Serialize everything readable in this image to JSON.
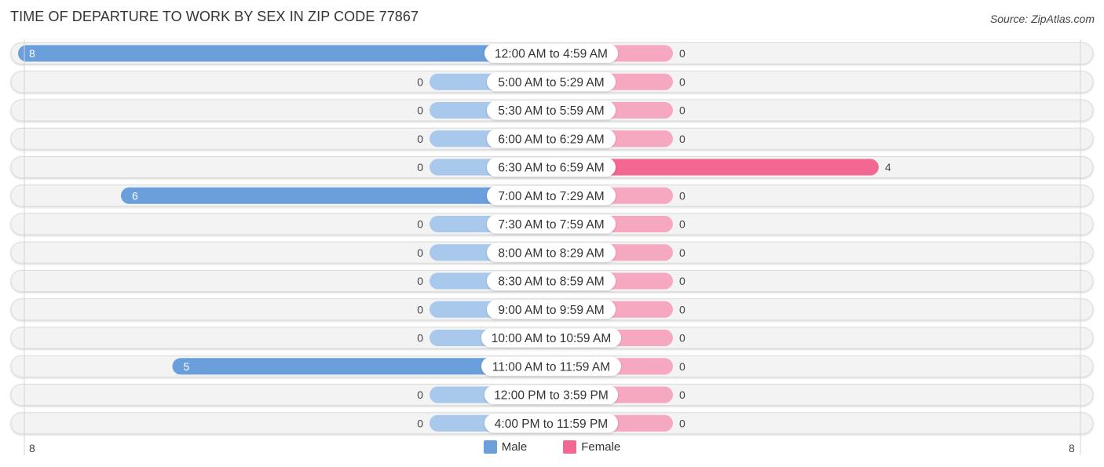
{
  "header": {
    "title": "TIME OF DEPARTURE TO WORK BY SEX IN ZIP CODE 77867",
    "source": "Source: ZipAtlas.com"
  },
  "colors": {
    "male": "#6a9fdb",
    "male_light": "#a8c8ec",
    "female": "#f26892",
    "female_light": "#f7a8c1",
    "track": "#f3f3f3",
    "label_bg": "#ffffff"
  },
  "legend": {
    "male_label": "Male",
    "female_label": "Female"
  },
  "axis": {
    "left_tick": "8",
    "right_tick": "8"
  },
  "chart_data": {
    "type": "bar",
    "orientation": "horizontal-diverging",
    "title": "TIME OF DEPARTURE TO WORK BY SEX IN ZIP CODE 77867",
    "xlabel": "",
    "ylabel": "",
    "xlim": [
      -8,
      8
    ],
    "legend_position": "bottom-center",
    "categories": [
      "12:00 AM to 4:59 AM",
      "5:00 AM to 5:29 AM",
      "5:30 AM to 5:59 AM",
      "6:00 AM to 6:29 AM",
      "6:30 AM to 6:59 AM",
      "7:00 AM to 7:29 AM",
      "7:30 AM to 7:59 AM",
      "8:00 AM to 8:29 AM",
      "8:30 AM to 8:59 AM",
      "9:00 AM to 9:59 AM",
      "10:00 AM to 10:59 AM",
      "11:00 AM to 11:59 AM",
      "12:00 PM to 3:59 PM",
      "4:00 PM to 11:59 PM"
    ],
    "series": [
      {
        "name": "Male",
        "values": [
          8,
          0,
          0,
          0,
          0,
          6,
          0,
          0,
          0,
          0,
          0,
          5,
          0,
          0
        ]
      },
      {
        "name": "Female",
        "values": [
          0,
          0,
          0,
          0,
          4,
          0,
          0,
          0,
          0,
          0,
          0,
          0,
          0,
          0
        ]
      }
    ]
  }
}
